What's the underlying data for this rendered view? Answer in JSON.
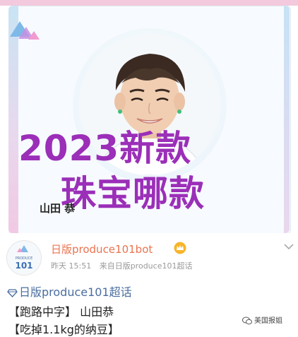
{
  "card": {
    "overlay_line_1": "2023新款",
    "overlay_line_2": "珠宝哪款",
    "name_tag": "山田 恭"
  },
  "post": {
    "account_name": "日版produce101bot",
    "time": "昨天 15:51",
    "source": "来自日版produce101超话",
    "topic": "日版produce101超话",
    "lines": [
      "【跑路中字】 山田恭",
      "【吃掉1.1kg的纳豆】"
    ]
  },
  "avatar": {
    "label_top": "PRODUCE",
    "label_bottom": "101"
  },
  "watermark": "美国报姐",
  "colors": {
    "overlay_text": "#9b2fb8",
    "account_name": "#eb7350",
    "topic": "#4a6ea0",
    "meta": "#999999"
  },
  "icons": [
    "vip-crown-icon",
    "chevron-down-icon",
    "topic-diamond-icon",
    "wechat-icon"
  ]
}
